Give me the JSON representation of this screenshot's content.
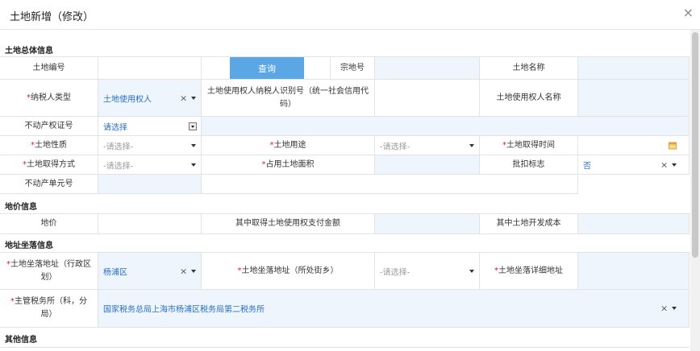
{
  "window": {
    "title": "土地新增（修改）",
    "close_glyph": "×"
  },
  "sections": {
    "general": "土地总体信息",
    "price": "地价信息",
    "location": "地址坐落信息",
    "other": "其他信息"
  },
  "general": {
    "land_no_label": "土地编号",
    "query_button": "查询",
    "parcel_no_label": "宗地号",
    "land_name_label": "土地名称",
    "taxpayer_type_label": "纳税人类型",
    "taxpayer_type_value": "土地使用权人",
    "user_id_label": "土地使用权人纳税人识别号（统一社会信用代码）",
    "user_name_label": "土地使用权人名称",
    "property_cert_label": "不动产权证号",
    "property_cert_placeholder": "请选择",
    "land_nature_label": "土地性质",
    "land_use_label": "土地用途",
    "acquire_time_label": "土地取得时间",
    "acquire_method_label": "土地取得方式",
    "area_label": "占用土地面积",
    "deduct_label": "批扣标志",
    "deduct_value": "否",
    "unit_no_label": "不动产单元号",
    "select_placeholder": "-请选择-"
  },
  "price": {
    "price_label": "地价",
    "fee_label": "其中取得土地使用权支付金额",
    "dev_cost_label": "其中土地开发成本"
  },
  "location": {
    "district_label": "土地坐落地址（行政区划）",
    "district_value": "杨浦区",
    "street_label": "土地坐落地址（所处街乡）",
    "detail_label": "土地坐落详细地址",
    "tax_office_label": "主管税务所（科，分局）",
    "tax_office_value": "国家税务总局上海市杨浦区税务局第二税务所"
  },
  "glyphs": {
    "clear": "×",
    "required": "*"
  }
}
